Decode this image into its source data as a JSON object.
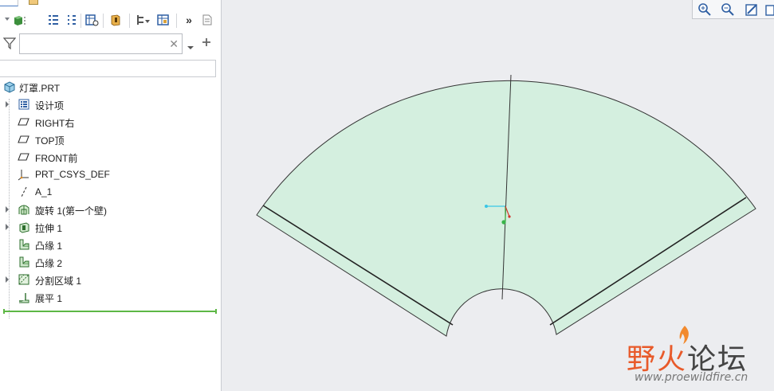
{
  "search": {
    "value": "",
    "placeholder": ""
  },
  "toolbar": {
    "more_label": "»"
  },
  "tree": {
    "root": {
      "label": "灯罩.PRT"
    },
    "items": [
      {
        "label": "设计项",
        "icon": "layers-icon",
        "expandable": true
      },
      {
        "label": "RIGHT右",
        "icon": "datum-plane-icon",
        "expandable": false
      },
      {
        "label": "TOP顶",
        "icon": "datum-plane-icon",
        "expandable": false
      },
      {
        "label": "FRONT前",
        "icon": "datum-plane-icon",
        "expandable": false
      },
      {
        "label": "PRT_CSYS_DEF",
        "icon": "csys-icon",
        "expandable": false
      },
      {
        "label": "A_1",
        "icon": "datum-axis-icon",
        "expandable": false
      },
      {
        "label": "旋转 1(第一个壁)",
        "icon": "revolve-wall-icon",
        "expandable": true
      },
      {
        "label": "拉伸 1",
        "icon": "extrude-icon",
        "expandable": true
      },
      {
        "label": "凸缘 1",
        "icon": "flange-icon",
        "expandable": false
      },
      {
        "label": "凸缘 2",
        "icon": "flange-icon",
        "expandable": false
      },
      {
        "label": "分割区域 1",
        "icon": "split-area-icon",
        "expandable": true
      },
      {
        "label": "展平 1",
        "icon": "unbend-icon",
        "expandable": false
      }
    ]
  },
  "watermark": {
    "chars": [
      "野",
      "火",
      "论坛"
    ],
    "url": "www.proewildfire.cn"
  },
  "colors": {
    "part_fill": "#d4efdf",
    "insert_line": "#5db745",
    "accent": "#4b7cc4"
  }
}
